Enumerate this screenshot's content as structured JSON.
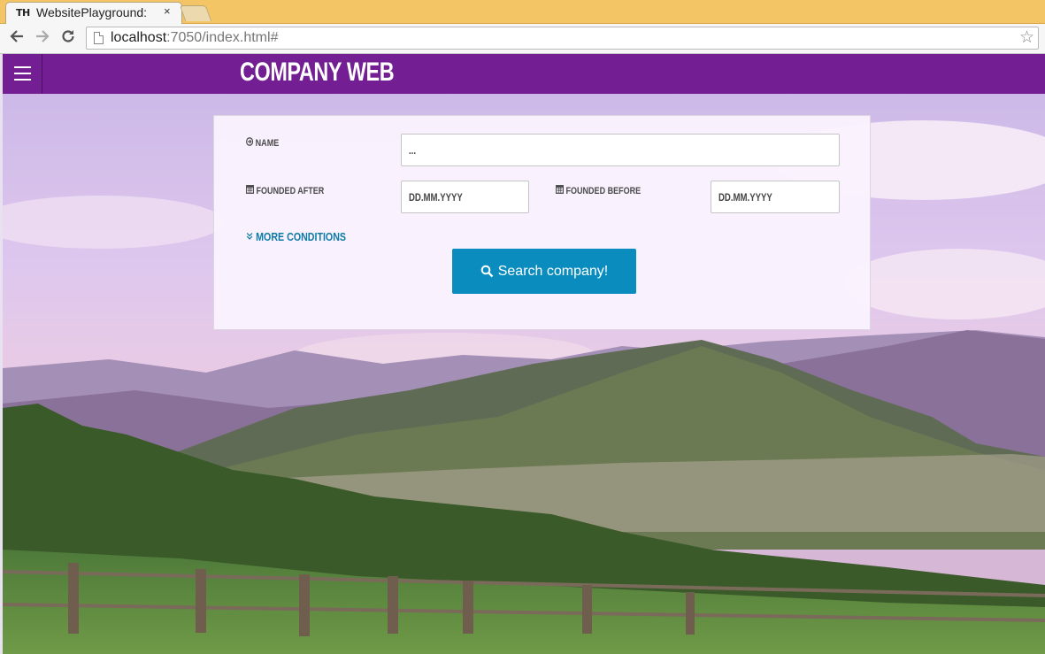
{
  "browser": {
    "favicon_text": "TH",
    "tab_title": "WebsitePlayground:",
    "tab_close": "×",
    "url_host": "localhost",
    "url_rest": ":7050/index.html#"
  },
  "app": {
    "brand": "COMPANY WEB",
    "colors": {
      "header": "#731e92",
      "button": "#0a8cbf",
      "link": "#0e7ba6"
    }
  },
  "form": {
    "name_label": "NAME",
    "name_value": "...",
    "founded_after_label": "FOUNDED AFTER",
    "founded_after_placeholder": "DD.MM.YYYY",
    "founded_before_label": "FOUNDED BEFORE",
    "founded_before_placeholder": "DD.MM.YYYY",
    "more_conditions_label": "MORE CONDITIONS",
    "search_button_label": "Search company!"
  },
  "icons": {
    "name": "arrow-circle-right-icon",
    "date": "calendar-icon",
    "more": "double-chevron-down-icon",
    "search": "search-icon"
  }
}
